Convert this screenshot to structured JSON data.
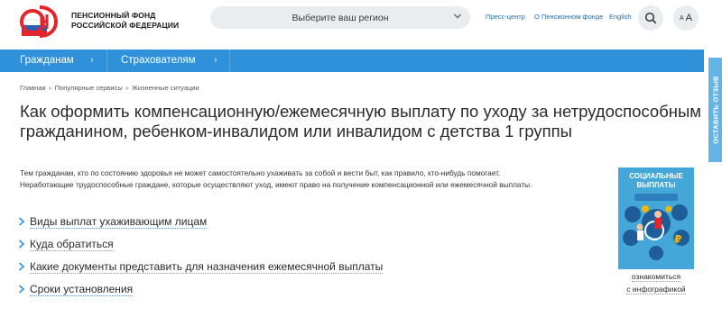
{
  "header": {
    "logo_line1": "ПЕНСИОННЫЙ ФОНД",
    "logo_line2": "РОССИЙСКОЙ ФЕДЕРАЦИИ",
    "region_label": "Выберите ваш регион",
    "links": [
      "Пресс-центр",
      "О Пенсионном фонде",
      "English"
    ],
    "font_small": "A",
    "font_big": "A",
    "icons": [
      "pfr-logo-icon",
      "chevron-down-icon",
      "search-icon"
    ],
    "accent_color": "#2e91d9",
    "logo_color": "#e3262c"
  },
  "nav": {
    "items": [
      "Гражданам",
      "Страхователям"
    ]
  },
  "breadcrumb": [
    "Главная",
    "Популярные сервисы",
    "Жизненные ситуации"
  ],
  "page": {
    "title": "Как оформить компенсационную/ежемесячную выплату по уходу за нетрудоспособным гражданином, ребенком-инвалидом или инвалидом с детства 1 группы",
    "intro_1": "Тем гражданам, кто по состоянию здоровья не может самостоятельно ухаживать за собой и вести быт, как правило, кто-нибудь помогает.",
    "intro_2": "Неработающие трудоспособные граждане, которые осуществляют уход, имеют право на получение компенсационной или ежемесячной выплаты."
  },
  "accordion": [
    "Виды выплат ухаживающим лицам",
    "Куда обратиться",
    "Какие документы представить для назначения ежемесячной выплаты",
    "Сроки установления"
  ],
  "infographic": {
    "title_line1": "СОЦИАЛЬНЫЕ",
    "title_line2": "ВЫПЛАТЫ",
    "link_line1": "ознакомиться",
    "link_line2": "с инфографикой"
  },
  "side_tab": {
    "label": "ОСТАВИТЬ ОТЗЫВ"
  }
}
